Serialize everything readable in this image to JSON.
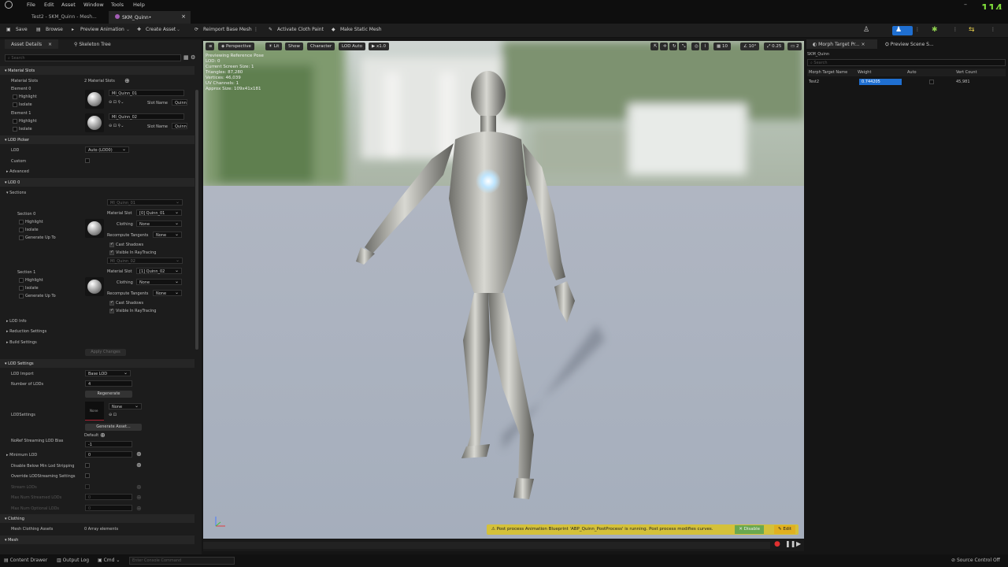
{
  "menu": [
    "File",
    "Edit",
    "Asset",
    "Window",
    "Tools",
    "Help"
  ],
  "fps": "114",
  "tabs": [
    {
      "label": "Test2 - SKM_Quinn - Mesh..."
    },
    {
      "label": "SKM_Quinn•"
    }
  ],
  "toolbar": {
    "save": "Save",
    "browse": "Browse",
    "preview_animation": "Preview Animation",
    "create_asset": "Create Asset",
    "reimport": "Reimport Base Mesh",
    "cloth_paint": "Activate Cloth Paint",
    "static_mesh": "Make Static Mesh"
  },
  "details": {
    "tab_asset": "Asset Details",
    "tab_skeleton": "Skeleton Tree",
    "search_placeholder": "Search",
    "sec_material_slots": "Material Slots",
    "material_slots_label": "Material Slots",
    "material_slots_value": "2 Material Slots",
    "element0": "Element 0",
    "element1": "Element 1",
    "highlight": "Highlight",
    "isolate": "Isolate",
    "mat0": "MI_Quinn_01",
    "mat1": "MI_Quinn_02",
    "slot_name": "Slot Name",
    "slot_val": "Quinn",
    "sec_lod_picker": "LOD Picker",
    "lod": "LOD",
    "lod_val": "Auto (LOD0)",
    "custom": "Custom",
    "advanced": "Advanced",
    "sec_lod0": "LOD 0",
    "sections": "Sections",
    "section0": "Section 0",
    "section1": "Section 1",
    "generate_up_to": "Generate Up To",
    "material_slot": "Material Slot",
    "slot0": "[0] Quinn_01",
    "slot1": "[1] Quinn_02",
    "clothing": "Clothing",
    "none": "None",
    "recompute": "Recompute Tangents",
    "cast_shadows": "Cast Shadows",
    "visible_rt": "Visible In RayTracing",
    "lod_info": "LOD Info",
    "reduction": "Reduction Settings",
    "build": "Build Settings",
    "apply": "Apply Changes",
    "sec_lod_settings": "LOD Settings",
    "lod_import": "LOD Import",
    "base_lod": "Base LOD",
    "num_lods": "Number of LODs",
    "num_lods_val": "4",
    "regenerate": "Regenerate",
    "lodsettings": "LODSettings",
    "generate_asset": "Generate Asset...",
    "noref": "NoRef Streaming LOD Bias",
    "default": "Default",
    "noref_val": "-1",
    "min_lod": "Minimum LOD",
    "min_lod_val": "0",
    "disable_below": "Disable Below Min Lod Stripping",
    "override": "Override LODStreaming Settings",
    "stream_lods": "Stream LODs",
    "max_streamed": "Max Num Streamed LODs",
    "max_optional": "Max Num Optional LODs",
    "zero": "0",
    "sec_clothing": "Clothing",
    "mesh_clothing": "Mesh Clothing Assets",
    "mesh_clothing_val": "0 Array elements",
    "sec_mesh": "Mesh"
  },
  "viewport": {
    "perspective": "Perspective",
    "lit": "Lit",
    "show": "Show",
    "character": "Character",
    "lod_auto": "LOD Auto",
    "speed": "x1.0",
    "stats": [
      "Previewing Reference Pose",
      "LOD: 0",
      "Current Screen Size: 1",
      "Triangles: 87,280",
      "Vertices: 46,039",
      "UV Channels: 1",
      "Approx Size: 109x41x181"
    ],
    "right_vals": [
      "10",
      "10°",
      "0.25",
      "2"
    ],
    "warning": "Post process Animation Blueprint 'ABP_Quinn_PostProcess' is running. Post process modifies curves.",
    "disable": "Disable",
    "edit": "Edit"
  },
  "morph": {
    "tab": "Morph Target Pr...",
    "tab2": "Preview Scene S...",
    "asset": "SKM_Quinn",
    "search_placeholder": "Search",
    "headers": [
      "Morph Target Name",
      "Weight",
      "Auto",
      "Vert Count"
    ],
    "rows": [
      {
        "name": "Test2",
        "weight": "0.744205",
        "verts": "45,981"
      }
    ]
  },
  "status": {
    "content_drawer": "Content Drawer",
    "output_log": "Output Log",
    "cmd": "Cmd",
    "console_placeholder": "Enter Console Command",
    "source_control": "Source Control Off"
  }
}
